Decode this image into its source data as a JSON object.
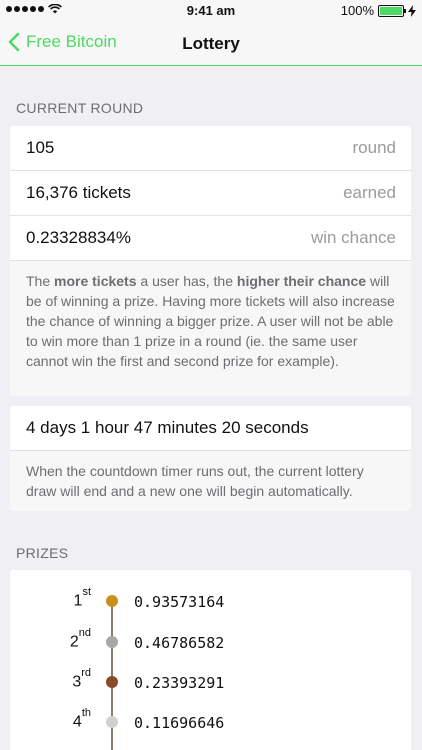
{
  "status_bar": {
    "time": "9:41 am",
    "battery": "100%"
  },
  "nav": {
    "back_label": "Free Bitcoin",
    "title": "Lottery"
  },
  "current_round": {
    "header": "CURRENT ROUND",
    "rows": [
      {
        "value": "105",
        "label": "round"
      },
      {
        "value": "16,376 tickets",
        "label": "earned"
      },
      {
        "value": "0.23328834%",
        "label": "win chance"
      }
    ],
    "desc": {
      "p1": "The ",
      "b1": "more tickets",
      "p2": " a user has, the ",
      "b2": "higher their chance",
      "p3": " will be of winning a prize. Having more tickets will also increase the chance of winning a bigger prize. A user will not be able to win more than 1 prize in a round (ie. the same user cannot win the first and second prize for example)."
    }
  },
  "countdown": {
    "value": "4 days 1 hour 47 minutes 20 seconds",
    "desc": "When the countdown timer runs out, the current lottery draw will end and a new one will begin automatically."
  },
  "prizes": {
    "header": "PRIZES",
    "items": [
      {
        "num": "1",
        "suffix": "st",
        "amount": "0.93573164",
        "color": "#c9901e"
      },
      {
        "num": "2",
        "suffix": "nd",
        "amount": "0.46786582",
        "color": "#a8a8a8"
      },
      {
        "num": "3",
        "suffix": "rd",
        "amount": "0.23393291",
        "color": "#8b4a2b"
      },
      {
        "num": "4",
        "suffix": "th",
        "amount": "0.11696646",
        "color": "#d0d0d0"
      }
    ]
  },
  "colors": {
    "accent": "#4cd964",
    "background": "#efeff4"
  }
}
